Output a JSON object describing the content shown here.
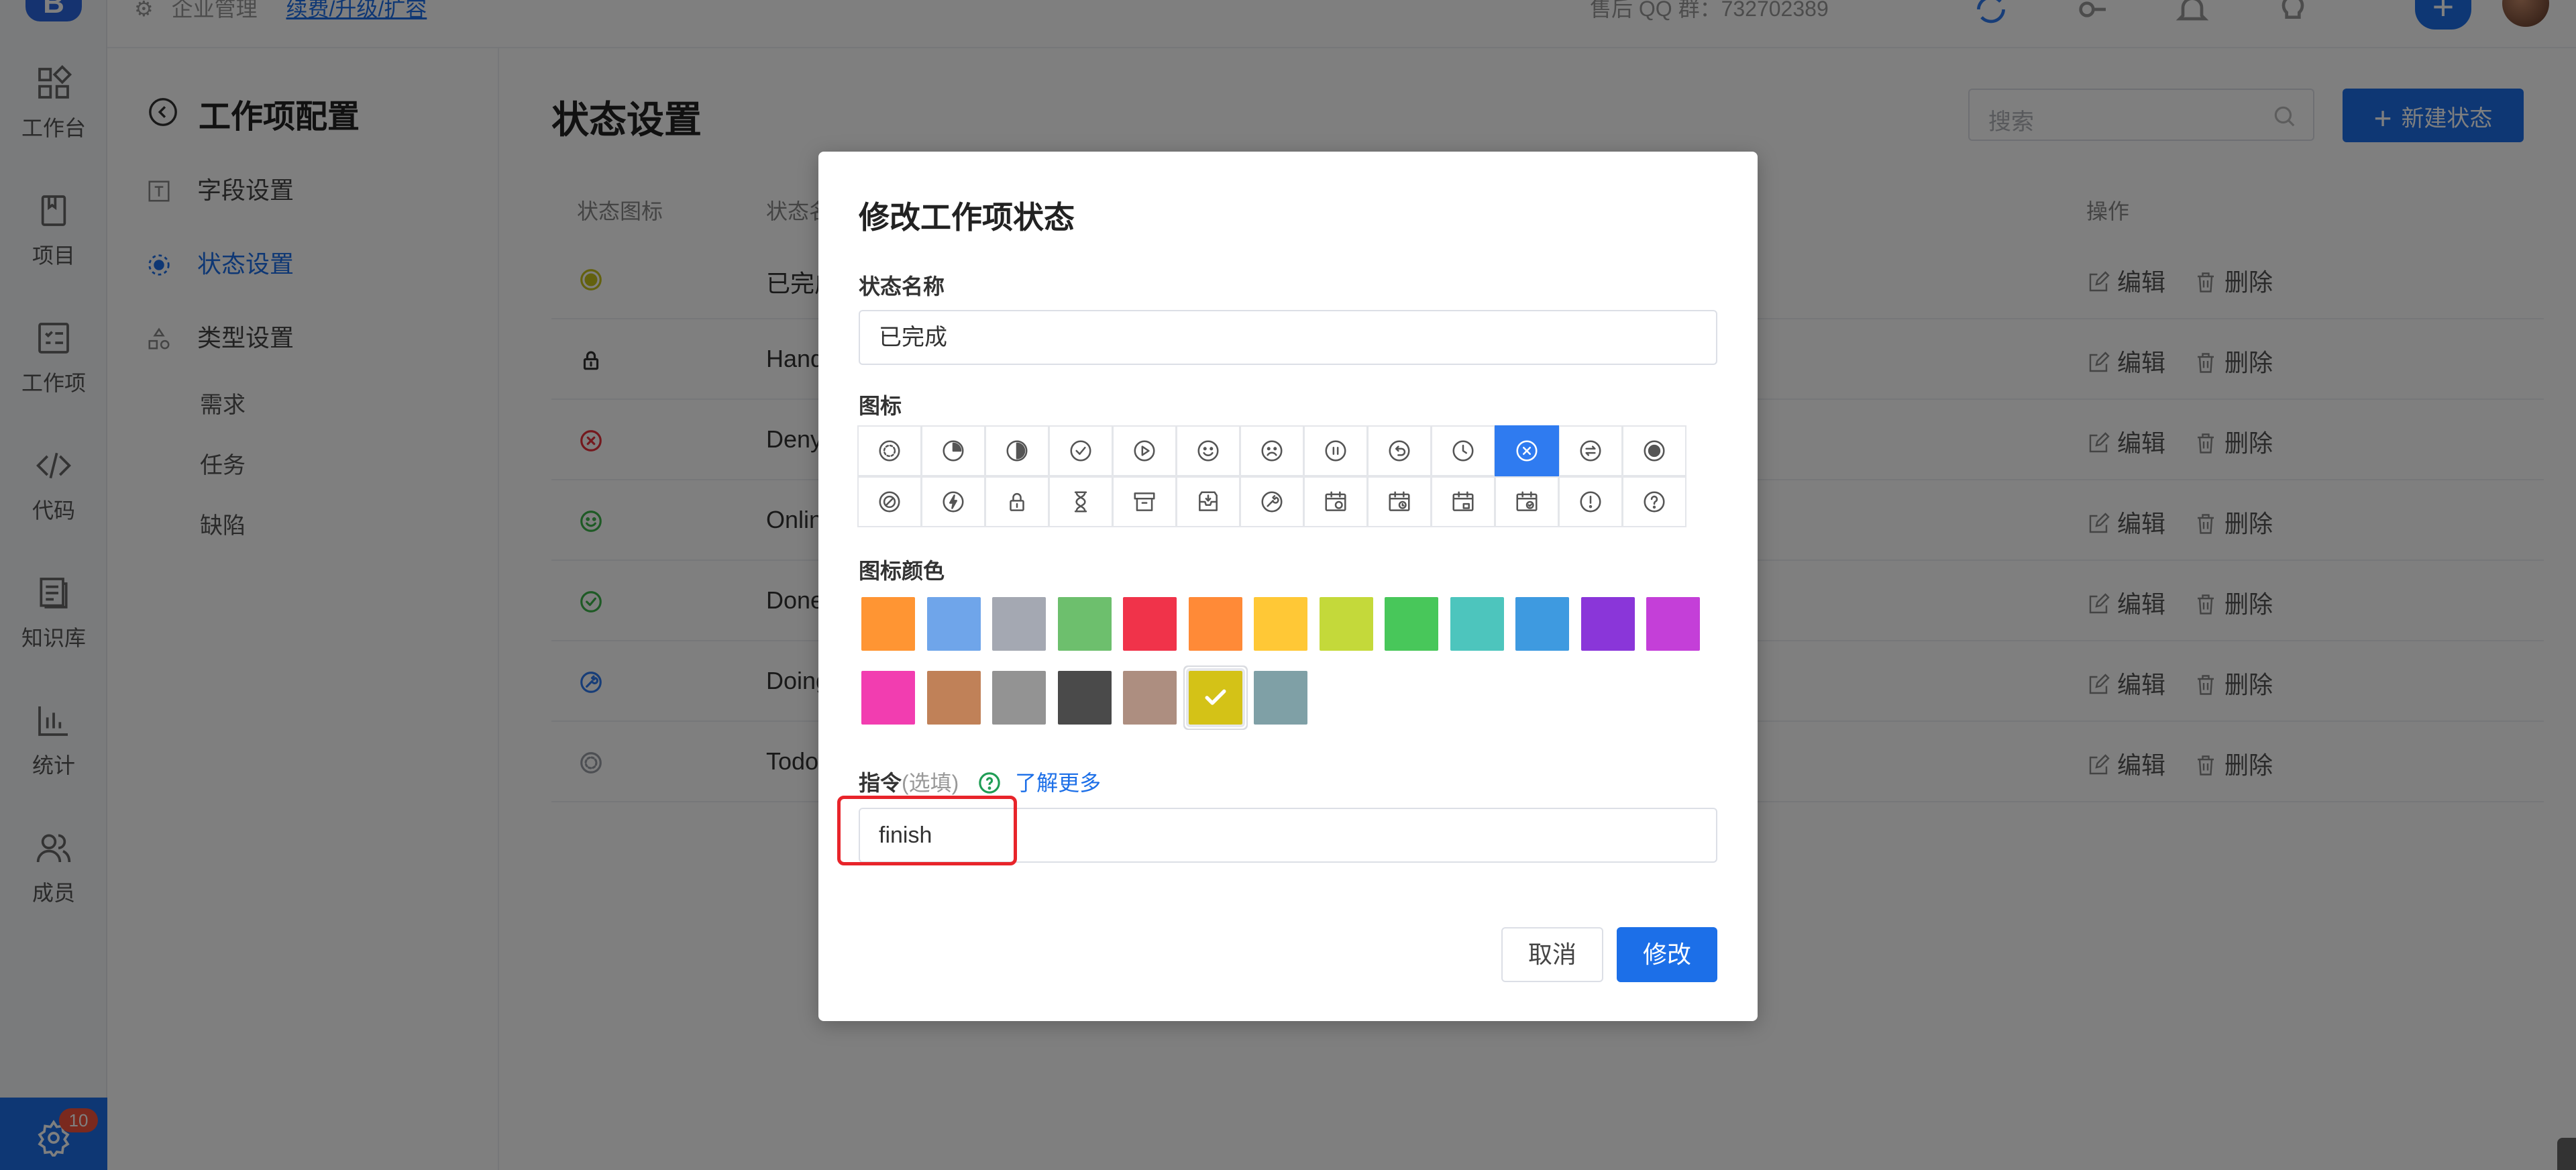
{
  "topbar": {
    "breadcrumb_root": "企业管理",
    "upgrade_link": "续费/升级/扩容",
    "support": "售后 QQ 群：732702389"
  },
  "leftnav": {
    "items": [
      {
        "label": "工作台",
        "icon": "dashboard-icon"
      },
      {
        "label": "项目",
        "icon": "book-icon"
      },
      {
        "label": "工作项",
        "icon": "checklist-icon"
      },
      {
        "label": "代码",
        "icon": "code-icon"
      },
      {
        "label": "知识库",
        "icon": "document-icon"
      },
      {
        "label": "统计",
        "icon": "bar-chart-icon"
      },
      {
        "label": "成员",
        "icon": "users-icon"
      }
    ],
    "settings_badge": "10"
  },
  "subside": {
    "title": "工作项配置",
    "items": [
      {
        "label": "字段设置"
      },
      {
        "label": "状态设置"
      },
      {
        "label": "类型设置"
      }
    ],
    "children": [
      "需求",
      "任务",
      "缺陷"
    ]
  },
  "main": {
    "title": "状态设置",
    "search_placeholder": "搜索",
    "new_button": "新建状态",
    "columns": {
      "icon": "状态图标",
      "name": "状态名",
      "ops": "操作"
    },
    "rows": [
      {
        "name": "已完成",
        "color": "#c7c21d"
      },
      {
        "name": "Hand",
        "color": "#333333"
      },
      {
        "name": "Deny",
        "color": "#e8313b"
      },
      {
        "name": "Onlin",
        "color": "#3cb54a"
      },
      {
        "name": "Done",
        "color": "#3cb54a"
      },
      {
        "name": "Doing",
        "color": "#2f7bf0"
      },
      {
        "name": "Todo",
        "color": "#9a9ea6"
      }
    ],
    "edit_label": "编辑",
    "delete_label": "删除"
  },
  "modal": {
    "title": "修改工作项状态",
    "name_label": "状态名称",
    "name_value": "已完成",
    "icon_label": "图标",
    "icons_row1": [
      "circle-dashed-icon",
      "progress-quarter-icon",
      "progress-half-icon",
      "check-circle-icon",
      "play-circle-icon",
      "smile-icon",
      "frown-icon",
      "pause-circle-icon",
      "undo-circle-icon",
      "clock-icon",
      "x-circle-icon",
      "transfer-circle-icon",
      "record-circle-icon"
    ],
    "icons_row2": [
      "forbidden-circle-icon",
      "bolt-circle-icon",
      "lock-icon",
      "hourglass-icon",
      "archive-icon",
      "inbox-icon",
      "wrench-circle-icon",
      "calendar-refresh-icon",
      "calendar-clock-icon",
      "calendar-lock-icon",
      "calendar-check-icon",
      "alert-circle-icon",
      "question-circle-icon"
    ],
    "selected_icon": "x-circle-icon",
    "color_label": "图标颜色",
    "colors": [
      "#ff9533",
      "#6fa5ea",
      "#a4a8b2",
      "#6dbf6d",
      "#f0334a",
      "#ff8a37",
      "#ffc836",
      "#c4d93a",
      "#48c75a",
      "#4dc5bd",
      "#3e9ae0",
      "#8a36d9",
      "#c43fd8",
      "#f23db0",
      "#c08158",
      "#939393",
      "#4a4a4a",
      "#ad8e80",
      "#d4c217",
      "#7fa0a6"
    ],
    "selected_color": "#d4c217",
    "cmd_label": "指令",
    "cmd_optional": "(选填)",
    "cmd_learn_more": "了解更多",
    "cmd_value": "finish",
    "cancel": "取消",
    "confirm": "修改"
  }
}
